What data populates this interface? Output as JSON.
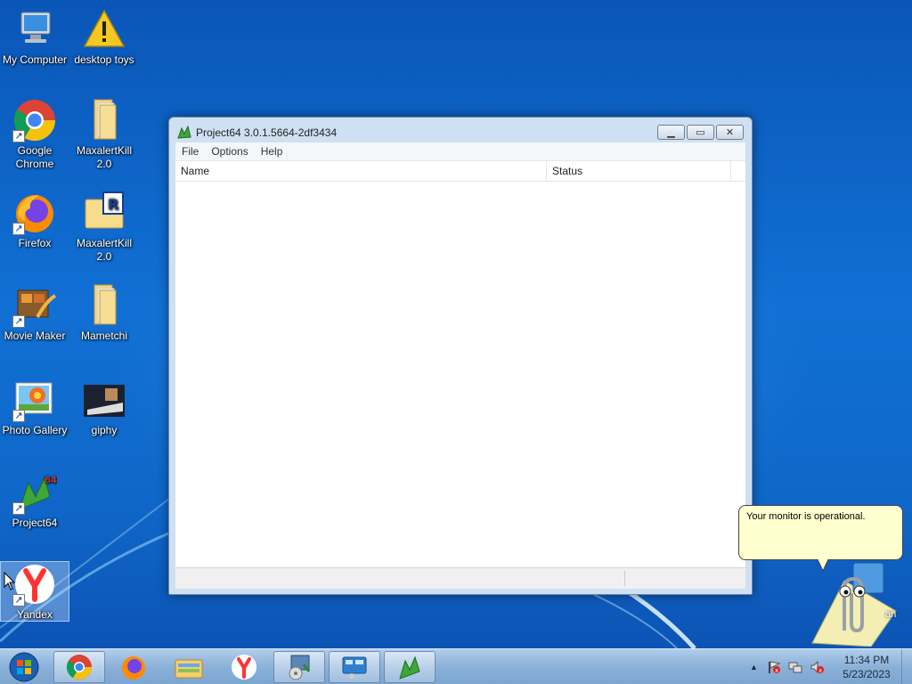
{
  "desktop": {
    "icons": [
      {
        "label": "My Computer",
        "icon": "computer-icon"
      },
      {
        "label": "desktop toys",
        "icon": "warning-icon"
      },
      {
        "label": "Google Chrome",
        "icon": "chrome-icon"
      },
      {
        "label": "MaxalertKill 2.0",
        "icon": "folder-icon"
      },
      {
        "label": "Firefox",
        "icon": "firefox-icon"
      },
      {
        "label": "MaxalertKill 2.0",
        "icon": "folder-r-icon"
      },
      {
        "label": "Movie Maker",
        "icon": "movie-maker-icon"
      },
      {
        "label": "Mametchi",
        "icon": "folder-icon"
      },
      {
        "label": "Photo Gallery",
        "icon": "photo-gallery-icon"
      },
      {
        "label": "giphy",
        "icon": "image-file-icon"
      },
      {
        "label": "Project64",
        "icon": "project64-icon"
      },
      {
        "label": "Yandex",
        "icon": "yandex-icon"
      }
    ]
  },
  "window": {
    "title": "Project64 3.0.1.5664-2df3434",
    "menu": [
      "File",
      "Options",
      "Help"
    ],
    "columns": [
      "Name",
      "Status"
    ]
  },
  "clippy": {
    "message": "Your monitor is operational.",
    "label_fragment": "an"
  },
  "taskbar": {
    "pinned": [
      "start-orb",
      "chrome-icon",
      "firefox-icon",
      "file-explorer-icon",
      "yandex-icon",
      "installer-icon",
      "control-panel-icon",
      "project64-icon"
    ],
    "clock_time": "11:34 PM",
    "clock_date": "5/23/2023"
  },
  "colors": {
    "desktop_bg": "#1170d4",
    "bubble_bg": "#ffffcf",
    "chrome_red": "#db4437",
    "yandex_red": "#f33"
  }
}
